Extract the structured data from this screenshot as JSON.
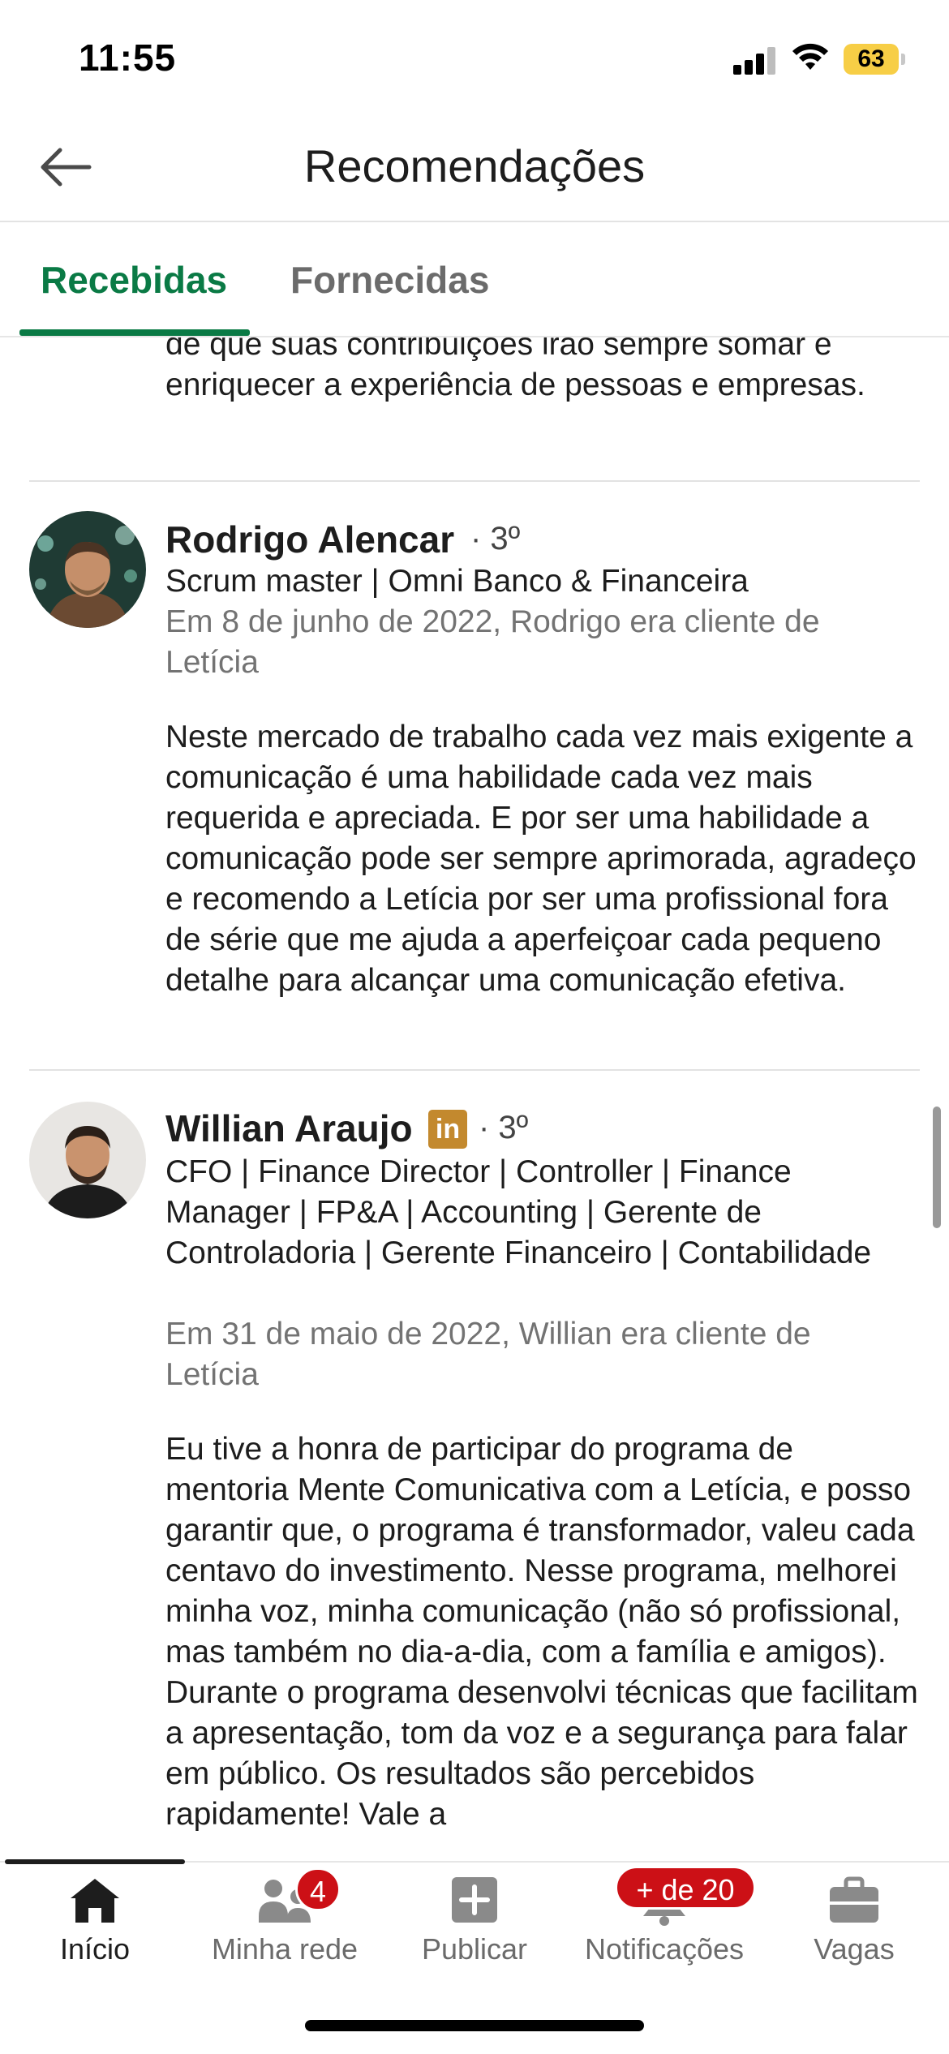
{
  "status_bar": {
    "time": "11:55",
    "battery": "63"
  },
  "header": {
    "title": "Recomendações"
  },
  "tabs": [
    {
      "label": "Recebidas",
      "active": true
    },
    {
      "label": "Fornecidas",
      "active": false
    }
  ],
  "previous_text": {
    "lines": "de que suas contribuições irão sempre somar e enriquecer a experiência de pessoas e empresas."
  },
  "recommendations": [
    {
      "name": "Rodrigo Alencar",
      "degree": "· 3º",
      "headline": "Scrum master | Omni Banco & Financeira",
      "meta": "Em 8 de junho de 2022, Rodrigo era cliente de Letícia",
      "text": "Neste mercado de trabalho cada vez mais exigente a comunicação é uma habilidade cada vez mais requerida e apreciada. E por ser uma habilidade a comunicação pode ser sempre aprimorada, agradeço e recomendo a Letícia por ser uma profissional fora de série que me ajuda a aperfeiçoar cada pequeno detalhe para alcançar uma comunicação efetiva."
    },
    {
      "name": "Willian Araujo",
      "badge": "in",
      "degree": "· 3º",
      "headline": "CFO | Finance Director | Controller | Finance Manager | FP&A | Accounting | Gerente de Controladoria | Gerente Financeiro | Contabilidade",
      "meta": "Em 31 de maio de 2022, Willian era cliente de Letícia",
      "text": "Eu tive a honra de participar do programa de mentoria Mente Comunicativa com a Letícia, e posso garantir que, o programa é transformador, valeu cada centavo do investimento. Nesse programa, melhorei minha voz, minha comunicação (não só profissional, mas também no dia-a-dia, com a família e amigos). Durante o programa desenvolvi técnicas que facilitam a apresentação, tom da voz e a segurança para falar em público. Os resultados são percebidos rapidamente! Vale a"
    }
  ],
  "bottom_nav": [
    {
      "label": "Início",
      "icon": "home-icon",
      "active": true
    },
    {
      "label": "Minha rede",
      "icon": "network-icon",
      "badge": "4"
    },
    {
      "label": "Publicar",
      "icon": "post-icon"
    },
    {
      "label": "Notificações",
      "icon": "bell-icon",
      "badge": "+ de 20"
    },
    {
      "label": "Vagas",
      "icon": "briefcase-icon"
    }
  ],
  "colors": {
    "accent": "#0a7a45",
    "badge": "#cc1016",
    "battery": "#f7ce46",
    "premium": "#c3892e"
  }
}
